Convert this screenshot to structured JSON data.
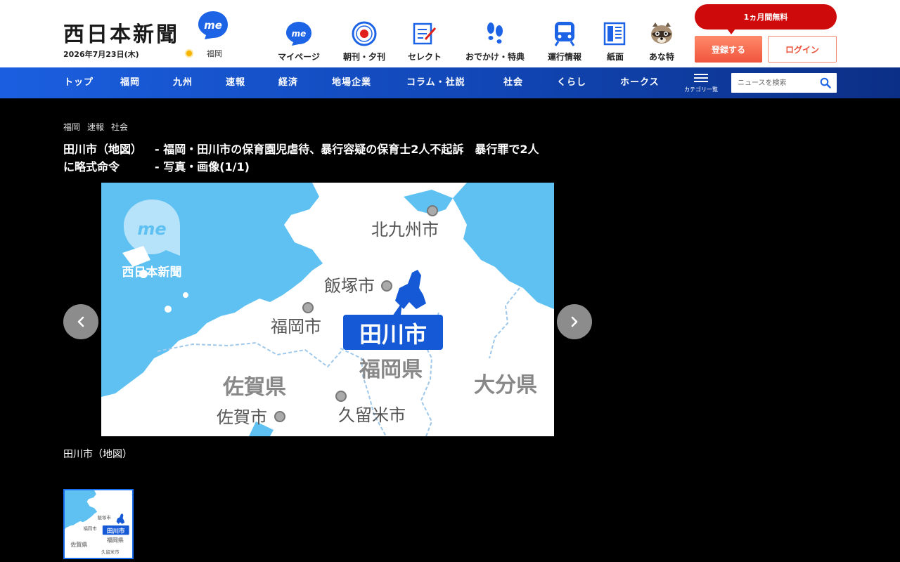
{
  "header": {
    "logo_text": "西日本新聞",
    "me_badge": "me",
    "date": "2026年7月23日(木)",
    "weather_city": "福岡",
    "weather_icon": "sun-icon",
    "nav": [
      {
        "label": "マイページ",
        "icon": "mypage-me-icon"
      },
      {
        "label": "朝刊・夕刊",
        "icon": "newspaper-edition-icon"
      },
      {
        "label": "セレクト",
        "icon": "select-pen-icon"
      },
      {
        "label": "おでかけ・特典",
        "icon": "footprints-icon"
      },
      {
        "label": "運行情報",
        "icon": "train-icon"
      },
      {
        "label": "紙面",
        "icon": "paper-page-icon"
      },
      {
        "label": "あな特",
        "icon": "raccoon-icon"
      }
    ],
    "free_trial": "1ヵ月間無料",
    "register": "登録する",
    "login": "ログイン"
  },
  "gnav": {
    "items": [
      "トップ",
      "福岡",
      "九州",
      "速報",
      "経済",
      "地場企業",
      "コラム・社説",
      "社会",
      "くらし",
      "ホークス"
    ],
    "category_label": "カテゴリ一覧",
    "search_placeholder": "ニュースを検索"
  },
  "article": {
    "breadcrumbs": [
      "福岡",
      "速報",
      "社会"
    ],
    "title_line1_a": "田川市（地図）",
    "title_line1_b": "- 福岡・田川市の保育園児虐待、暴行容疑の保育士2人不起訴　暴行罪で2人",
    "title_line2_a": "に略式命令",
    "title_line2_b": "- 写真・画像(1/1)",
    "caption": "田川市（地図）"
  },
  "map": {
    "watermark_me": "me",
    "watermark_name": "西日本新聞",
    "highlight_city": "田川市",
    "labels": [
      "北九州市",
      "飯塚市",
      "福岡市",
      "福岡県",
      "佐賀県",
      "大分県",
      "佐賀市",
      "久留米市"
    ],
    "sea_color": "#5ec1f2",
    "land_color": "#ffffff",
    "highlight_color": "#1559d6"
  },
  "colors": {
    "nav_blue": "#1146b5",
    "brand_red": "#cf0a0a",
    "register_orange": "#f0553d"
  }
}
